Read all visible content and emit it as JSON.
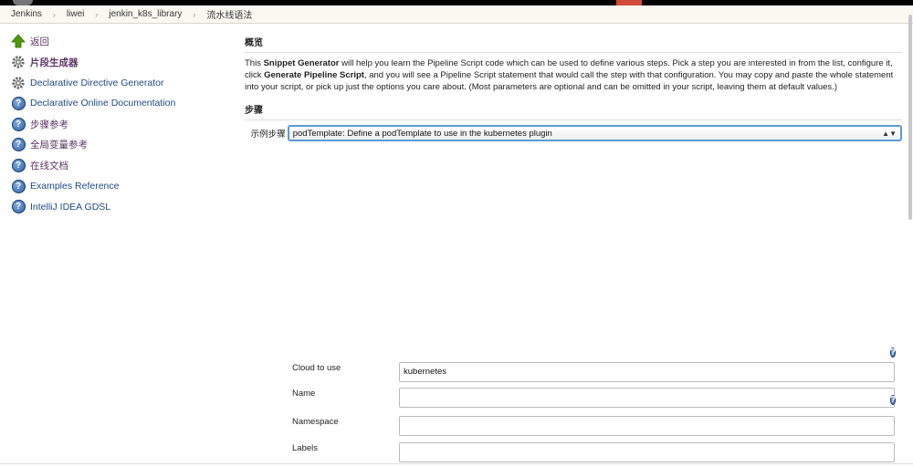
{
  "breadcrumb": [
    "Jenkins",
    "liwei",
    "jenkin_k8s_library",
    "流水线语法"
  ],
  "breadcrumb_sep": "›",
  "sidebar": {
    "items": [
      {
        "label": "返回",
        "icon": "up-arrow-icon"
      },
      {
        "label": "片段生成器",
        "icon": "gear-icon"
      },
      {
        "label": "Declarative Directive Generator",
        "icon": "gear-icon"
      },
      {
        "label": "Declarative Online Documentation",
        "icon": "help-icon"
      },
      {
        "label": "步骤参考",
        "icon": "help-icon"
      },
      {
        "label": "全局变量参考",
        "icon": "help-icon"
      },
      {
        "label": "在线文档",
        "icon": "help-icon"
      },
      {
        "label": "Examples Reference",
        "icon": "help-icon"
      },
      {
        "label": "IntelliJ IDEA GDSL",
        "icon": "help-icon"
      }
    ]
  },
  "main": {
    "overview_title": "概览",
    "desc": {
      "p1": "This ",
      "b1": "Snippet Generator",
      "p2": " will help you learn the Pipeline Script code which can be used to define various steps. Pick a step you are interested in from the list, configure it, click ",
      "b2": "Generate Pipeline Script",
      "p3": ", and you will see a Pipeline Script statement that would call the step with that configuration. You may copy and paste the whole statement into your script, or pick up just the options you care about. (Most parameters are optional and can be omitted in your script, leaving them at default values.)"
    },
    "steps_title": "步骤",
    "sample_step_label": "示例步骤",
    "sample_step_value": "podTemplate: Define a podTemplate to use in the kubernetes plugin",
    "select_arrows": "▲▼"
  },
  "form": {
    "help_glyph": "?",
    "fields": [
      {
        "label": "Cloud to use",
        "value": "kubernetes"
      },
      {
        "label": "Name",
        "value": ""
      },
      {
        "label": "Namespace",
        "value": ""
      },
      {
        "label": "Labels",
        "value": ""
      }
    ]
  },
  "colors": {
    "link": "#204a87",
    "accent": "#5b9bd5",
    "topbar_red": "#d24939"
  }
}
